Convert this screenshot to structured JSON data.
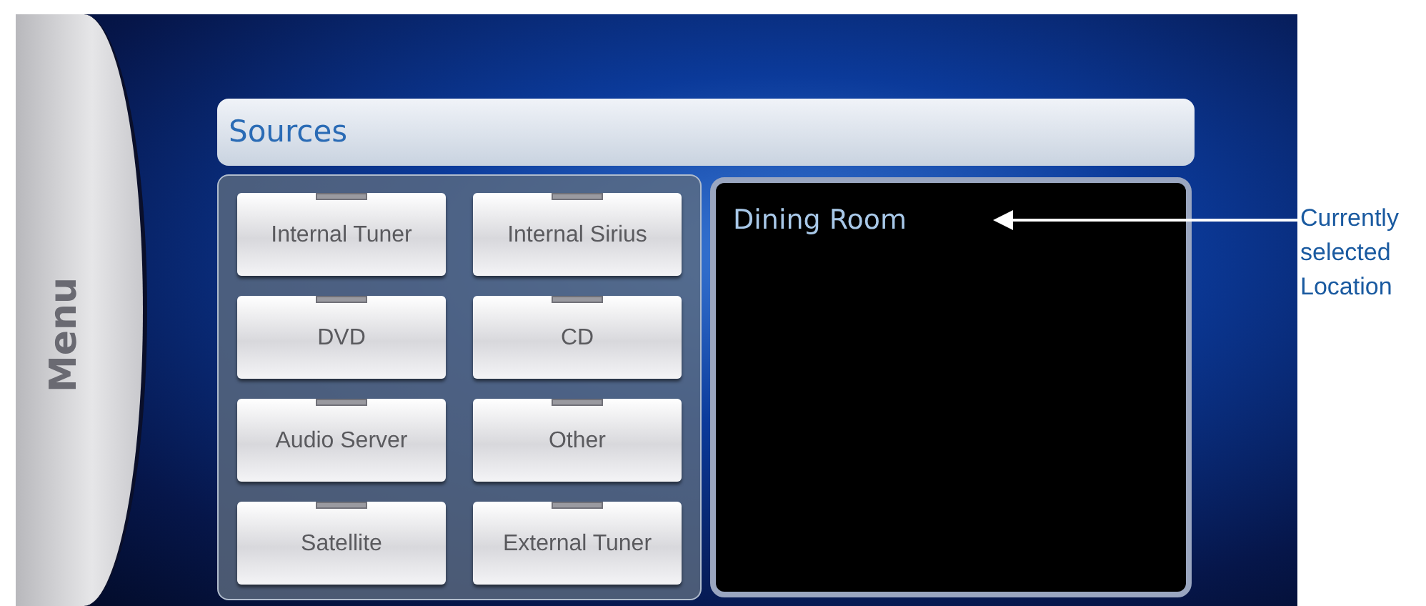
{
  "menu": {
    "label": "Menu"
  },
  "sources_panel": {
    "title": "Sources",
    "buttons": [
      "Internal Tuner",
      "Internal Sirius",
      "DVD",
      "CD",
      "Audio Server",
      "Other",
      "Satellite",
      "External Tuner"
    ]
  },
  "location_panel": {
    "location": "Dining Room"
  },
  "annotation": {
    "text": "Currently selected Location"
  }
}
